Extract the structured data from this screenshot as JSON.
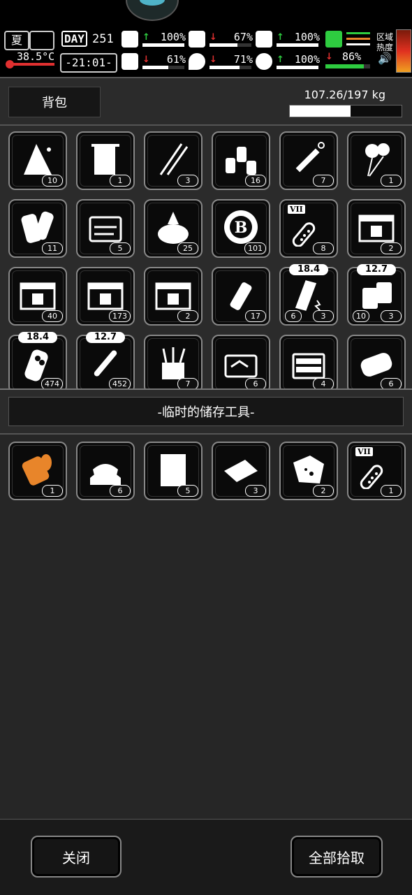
{
  "hud": {
    "season": "夏",
    "temperature": "38.5°C",
    "day_label": "DAY",
    "day_number": "251",
    "clock": "-21:01-",
    "stats": [
      {
        "name": "health",
        "arrow": "up",
        "value": "100%",
        "fill": 1.0,
        "color": "#ffffff"
      },
      {
        "name": "hunger",
        "arrow": "down",
        "value": "67%",
        "fill": 0.67,
        "color": "#ffffff"
      },
      {
        "name": "sanity",
        "arrow": "up",
        "value": "100%",
        "fill": 1.0,
        "color": "#ffffff"
      },
      {
        "name": "brain",
        "arrow": "down",
        "value": "61%",
        "fill": 0.61,
        "color": "#ffffff"
      },
      {
        "name": "thirst",
        "arrow": "down",
        "value": "71%",
        "fill": 0.71,
        "color": "#ffffff"
      },
      {
        "name": "heart",
        "arrow": "up",
        "value": "100%",
        "fill": 1.0,
        "color": "#ffffff"
      }
    ],
    "stamina": {
      "arrow": "down",
      "value": "86%",
      "fill": 0.86,
      "color": "#2ecc40"
    },
    "zone_label_1": "区域",
    "zone_label_2": "热度",
    "arrow_up_color": "#2ecc40",
    "arrow_down_color": "#e03030"
  },
  "backpack": {
    "tab_label": "背包",
    "weight_text": "107.26/197 kg",
    "weight_fill": 0.5445,
    "items": [
      {
        "icon": "rag-icon",
        "count": "10"
      },
      {
        "icon": "towel-icon",
        "count": "1"
      },
      {
        "icon": "needles-icon",
        "count": "3"
      },
      {
        "icon": "bottles-icon",
        "count": "16"
      },
      {
        "icon": "syringe-icon",
        "count": "7"
      },
      {
        "icon": "balloon-icon",
        "count": "1"
      },
      {
        "icon": "scroll-icon",
        "count": "11"
      },
      {
        "icon": "toolbox-icon",
        "count": "5"
      },
      {
        "icon": "sack-icon",
        "count": "25"
      },
      {
        "icon": "coin-icon",
        "count": "101"
      },
      {
        "icon": "vial-icon",
        "count": "8",
        "tag": "VII"
      },
      {
        "icon": "crate-icon",
        "count": "2"
      },
      {
        "icon": "crate-icon",
        "count": "40"
      },
      {
        "icon": "crate-icon",
        "count": "173"
      },
      {
        "icon": "crate-icon",
        "count": "2"
      },
      {
        "icon": "grenade-icon",
        "count": "17"
      },
      {
        "icon": "magazine-icon",
        "count": "3",
        "count2": "6",
        "badge": "18.4"
      },
      {
        "icon": "ammo-box-icon",
        "count": "3",
        "count2": "10",
        "badge": "12.7"
      },
      {
        "icon": "shells-icon",
        "count": "474",
        "badge": "18.4"
      },
      {
        "icon": "bullet-icon",
        "count": "452",
        "badge": "12.7"
      },
      {
        "icon": "tools-cup-icon",
        "count": "7"
      },
      {
        "icon": "tool-case-icon",
        "count": "6"
      },
      {
        "icon": "tool-chest-icon",
        "count": "4"
      },
      {
        "icon": "can-icon",
        "count": "6"
      }
    ]
  },
  "storage": {
    "title": "-临时的储存工具-",
    "items": [
      {
        "icon": "pipe-fitting-icon",
        "count": "1",
        "color": "#e8852a"
      },
      {
        "icon": "cloth-pile-icon",
        "count": "6"
      },
      {
        "icon": "paper-icon",
        "count": "5"
      },
      {
        "icon": "fabric-icon",
        "count": "3"
      },
      {
        "icon": "ore-icon",
        "count": "2"
      },
      {
        "icon": "vial-icon",
        "count": "1",
        "tag": "VII"
      }
    ]
  },
  "footer": {
    "close_label": "关闭",
    "pickup_label": "全部拾取"
  }
}
